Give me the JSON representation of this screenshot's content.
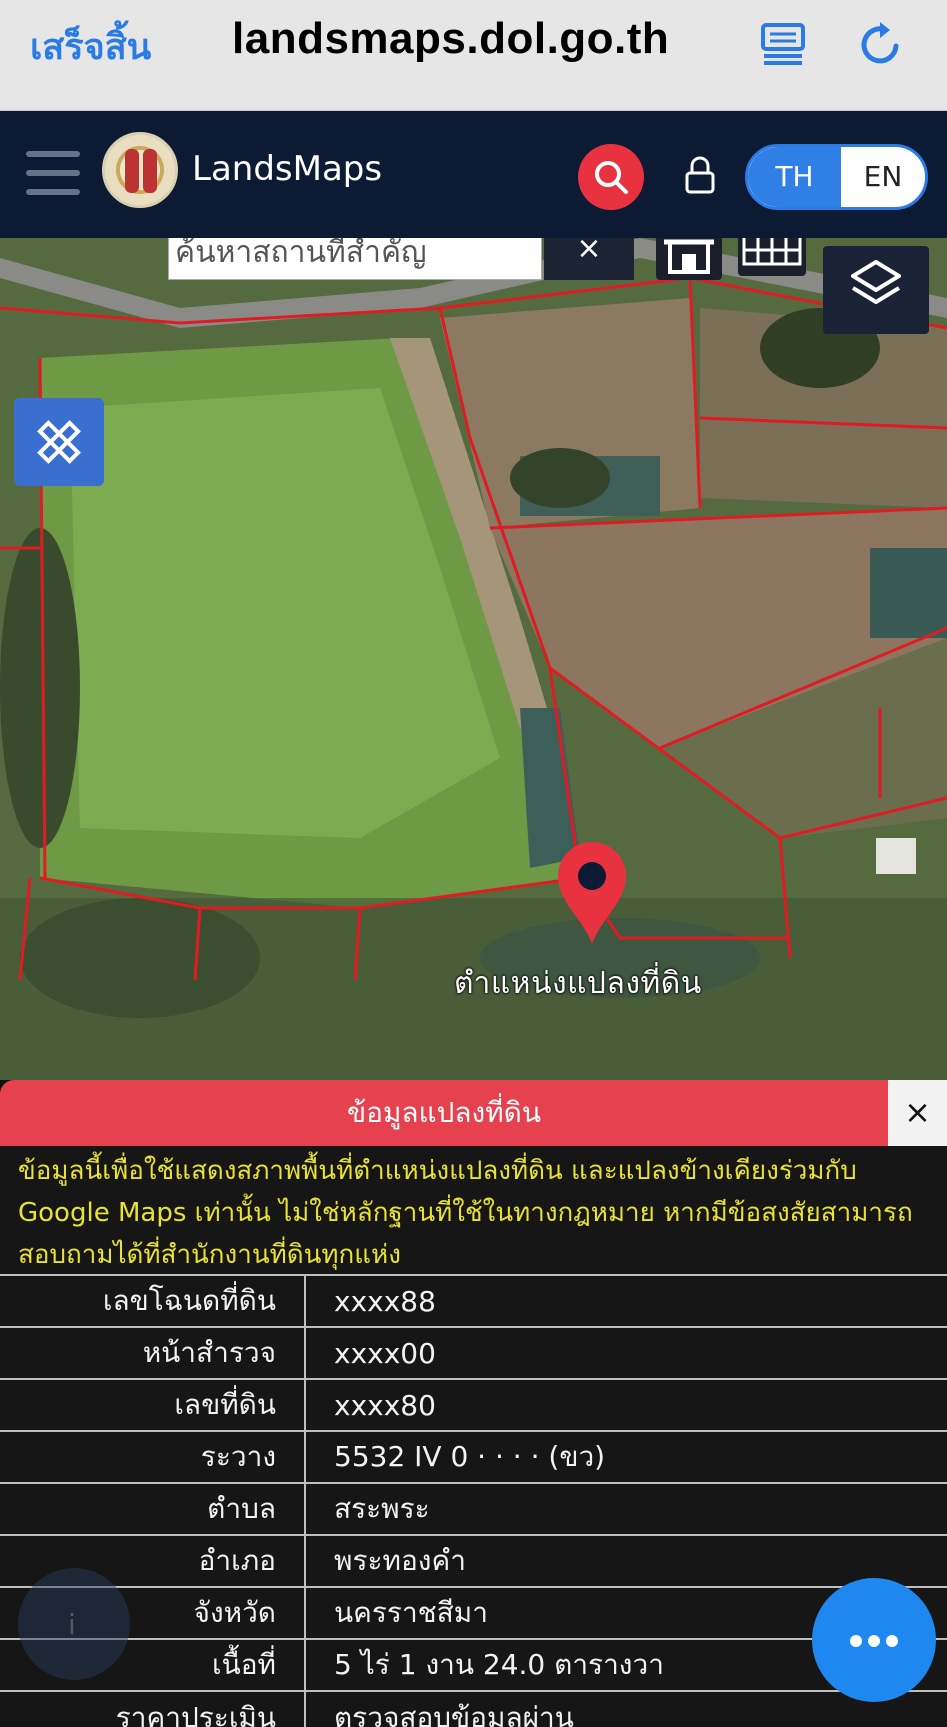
{
  "browser": {
    "done_label": "เสร็จสิ้น",
    "url": "landsmaps.dol.go.th",
    "icons": [
      "reader-icon",
      "reload-icon"
    ],
    "accent": "#2b7be5"
  },
  "appbar": {
    "brand": "LandsMaps",
    "lang_th": "TH",
    "lang_en": "EN",
    "background": "#0d1a33",
    "search_color": "#e8323f"
  },
  "map": {
    "search_placeholder": "ค้นหาสถานที่สำคัญ",
    "search_clear": "×",
    "pin_label": "ตำแหน่งแปลงที่ดิน",
    "pin_color": "#e8323f"
  },
  "panel": {
    "title": "ข้อมูลแปลงที่ดิน",
    "close": "×",
    "notice": "ข้อมูลนี้เพื่อใช้แสดงสภาพพื้นที่ตำแหน่งแปลงที่ดิน และแปลงข้างเคียงร่วมกับ Google Maps เท่านั้น ไม่ใช่หลักฐานที่ใช้ในทางกฎหมาย หากมีข้อสงสัยสามารถสอบถามได้ที่สำนักงานที่ดินทุกแห่ง",
    "rows": [
      {
        "key": "เลขโฉนดที่ดิน",
        "value": "xxxx88"
      },
      {
        "key": "หน้าสำรวจ",
        "value": "xxxx00"
      },
      {
        "key": "เลขที่ดิน",
        "value": "xxxx80"
      },
      {
        "key": "ระวาง",
        "value": "5532 IV 0 · · · · (ขว)"
      },
      {
        "key": "ตำบล",
        "value": "สระพระ"
      },
      {
        "key": "อำเภอ",
        "value": "พระทองคำ"
      },
      {
        "key": "จังหวัด",
        "value": "นครราชสีมา"
      },
      {
        "key": "เนื้อที่",
        "value": "5 ไร่ 1 งาน 24.0 ตารางวา"
      },
      {
        "key": "ราคาประเมิน",
        "value": "ตรวจสอบข้อมูลผ่าน"
      }
    ],
    "header_color": "#e5414e",
    "notice_color": "#e9e232"
  }
}
